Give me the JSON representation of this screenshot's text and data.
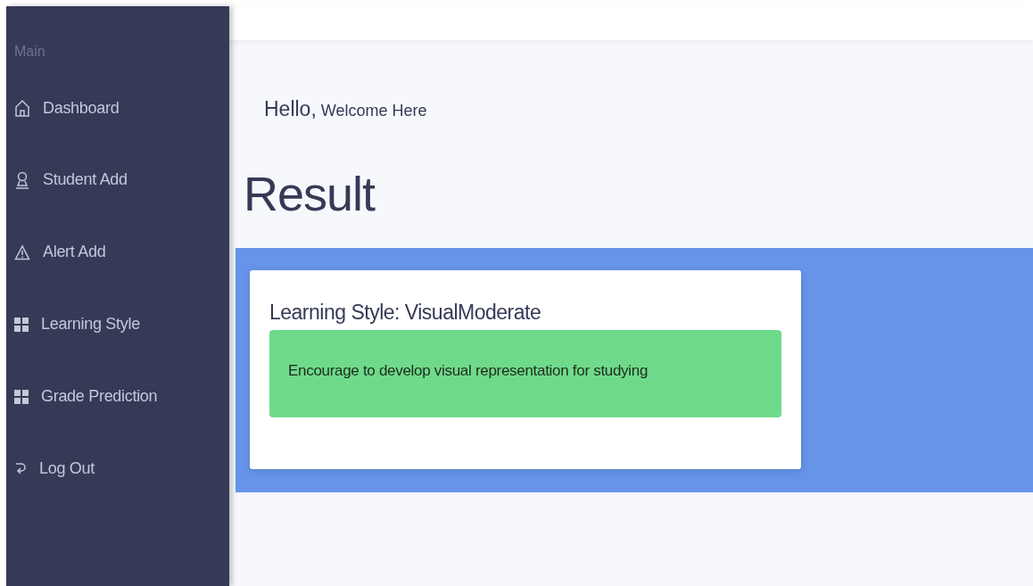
{
  "sidebar": {
    "heading": "Main",
    "items": [
      {
        "label": "Dashboard",
        "kind": "home"
      },
      {
        "label": "Student Add",
        "kind": "user"
      },
      {
        "label": "Alert Add",
        "kind": "alert"
      },
      {
        "label": "Learning Style",
        "kind": "grid"
      },
      {
        "label": "Grade Prediction",
        "kind": "grid"
      },
      {
        "label": "Log Out",
        "kind": "logout"
      }
    ]
  },
  "greeting": {
    "hello": "Hello,",
    "welcome": "Welcome Here"
  },
  "page_title": "Result",
  "result": {
    "title": "Learning Style: VisualModerate",
    "message": "Encourage to develop visual representation for studying"
  }
}
